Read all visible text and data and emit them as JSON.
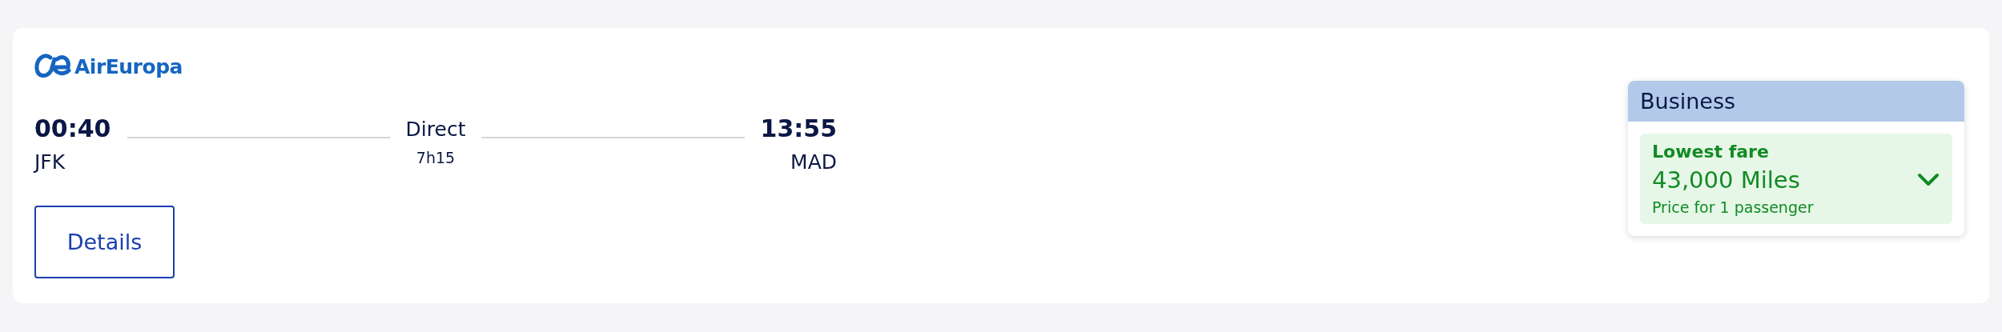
{
  "airline": {
    "name": "AirEuropa"
  },
  "departure": {
    "time": "00:40",
    "airport": "JFK"
  },
  "stops": {
    "label": "Direct",
    "duration": "7h15"
  },
  "arrival": {
    "time": "13:55",
    "airport": "MAD"
  },
  "details_button": {
    "label": "Details"
  },
  "fare": {
    "cabin": "Business",
    "tag": "Lowest fare",
    "price": "43,000 Miles",
    "note": "Price for 1 passenger",
    "expanded": false
  }
}
